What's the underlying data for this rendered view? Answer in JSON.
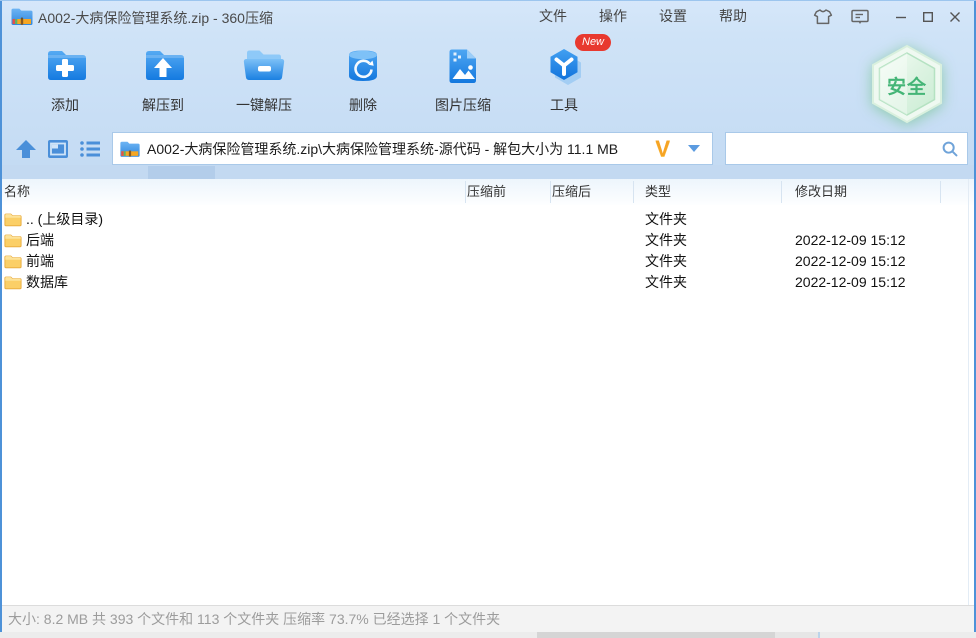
{
  "window": {
    "title": "A002-大病保险管理系统.zip - 360压缩",
    "menu": [
      {
        "label": "文件"
      },
      {
        "label": "操作"
      },
      {
        "label": "设置"
      },
      {
        "label": "帮助"
      }
    ]
  },
  "toolbar": {
    "buttons": [
      {
        "label": "添加",
        "icon": "folder-plus-icon"
      },
      {
        "label": "解压到",
        "icon": "folder-extract-icon"
      },
      {
        "label": "一键解压",
        "icon": "folder-open-icon"
      },
      {
        "label": "删除",
        "icon": "trash-recycle-icon"
      },
      {
        "label": "图片压缩",
        "icon": "image-compress-icon"
      },
      {
        "label": "工具",
        "icon": "tools-cube-icon",
        "badge": "New"
      }
    ],
    "security_badge": "安全"
  },
  "addressbar": {
    "path": "A002-大病保险管理系统.zip\\大病保险管理系统-源代码 - 解包大小为 11.1 MB",
    "logo": "V",
    "search_value": ""
  },
  "list": {
    "columns": [
      "名称",
      "压缩前",
      "压缩后",
      "类型",
      "修改日期"
    ],
    "rows": [
      {
        "name": ".. (上级目录)",
        "size_before": "",
        "size_after": "",
        "type": "文件夹",
        "modified": ""
      },
      {
        "name": "后端",
        "size_before": "",
        "size_after": "",
        "type": "文件夹",
        "modified": "2022-12-09 15:12"
      },
      {
        "name": "前端",
        "size_before": "",
        "size_after": "",
        "type": "文件夹",
        "modified": "2022-12-09 15:12"
      },
      {
        "name": "数据库",
        "size_before": "",
        "size_after": "",
        "type": "文件夹",
        "modified": "2022-12-09 15:12"
      }
    ]
  },
  "statusbar": {
    "text": "大小: 8.2 MB 共 393 个文件和 113 个文件夹 压缩率 73.7% 已经选择 1 个文件夹"
  },
  "colors": {
    "accent_blue": "#1f86e8",
    "chrome_blue": "#cfe3f7",
    "badge_red": "#e8392f",
    "safe_green": "#45b577",
    "folder_yellow": "#fbcf67"
  }
}
